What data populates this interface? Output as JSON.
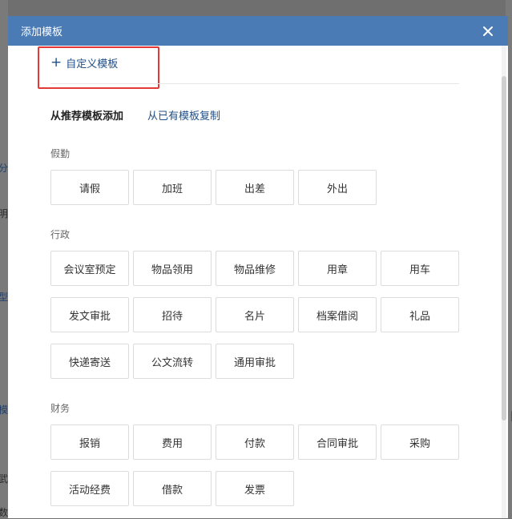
{
  "background": {
    "left_fragments": [
      "分",
      "明",
      "型",
      "模",
      "武",
      "数"
    ],
    "right_fragments": [
      "|"
    ]
  },
  "modal": {
    "title": "添加模板",
    "close_icon": "close-icon",
    "custom_template": {
      "icon": "plus-icon",
      "label": "自定义模板"
    },
    "source_tabs": {
      "recommended": "从推荐模板添加",
      "copy_existing": "从已有模板复制"
    },
    "sections": [
      {
        "label": "假勤",
        "items": [
          "请假",
          "加班",
          "出差",
          "外出"
        ]
      },
      {
        "label": "行政",
        "items": [
          "会议室预定",
          "物品领用",
          "物品维修",
          "用章",
          "用车",
          "发文审批",
          "招待",
          "名片",
          "档案借阅",
          "礼品",
          "快递寄送",
          "公文流转",
          "通用审批"
        ]
      },
      {
        "label": "财务",
        "items": [
          "报销",
          "费用",
          "付款",
          "合同审批",
          "采购",
          "活动经费",
          "借款",
          "发票"
        ]
      }
    ]
  },
  "colors": {
    "header": "#4a7bb5",
    "link": "#1f4f86",
    "highlight": "#e53935"
  }
}
